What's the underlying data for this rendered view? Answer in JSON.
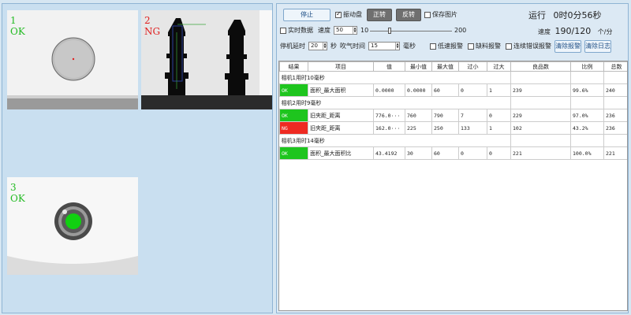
{
  "cameras": [
    {
      "index": "1",
      "result": "OK",
      "color": "#22bb22"
    },
    {
      "index": "2",
      "result": "NG",
      "color": "#e02020"
    },
    {
      "index": "3",
      "result": "OK",
      "color": "#22bb22"
    }
  ],
  "controls": {
    "stop_label": "停止",
    "vibrate_label": "振动盘",
    "forward_label": "正转",
    "reverse_label": "反转",
    "save_image_label": "保存图片",
    "realtime_label": "实时数据",
    "speed_label": "速度",
    "speed_value": "50",
    "slider_min": "10",
    "slider_max": "200",
    "stop_delay_label": "停机延时",
    "stop_delay_value": "20",
    "stop_delay_unit": "秒",
    "blow_time_label": "吹气时间",
    "blow_time_value": "15",
    "blow_time_unit": "毫秒",
    "low_speed_alarm_label": "低速报警",
    "missing_alarm_label": "缺料报警",
    "consecutive_alarm_label": "连续错误报警",
    "clear_alarm_label": "清除报警",
    "clear_log_label": "清除日志"
  },
  "status": {
    "run_label": "运行",
    "run_time": "0时0分56秒",
    "speed_label": "速度",
    "speed_value": "190/120",
    "speed_unit": "个/分"
  },
  "table": {
    "headers": [
      "结果",
      "项目",
      "值",
      "最小值",
      "最大值",
      "过小",
      "过大",
      "良品数",
      "比例",
      "总数"
    ],
    "groups": [
      {
        "title": "相机1用时10毫秒",
        "rows": [
          {
            "result": "OK",
            "item": "面积_最大面积",
            "value": "0.0000",
            "min": "0.0000",
            "max": "60",
            "too_small": "0",
            "too_large": "1",
            "good": "239",
            "ratio": "99.6%",
            "total": "240"
          }
        ]
      },
      {
        "title": "相机2用时9毫秒",
        "rows": [
          {
            "result": "OK",
            "item": "旧夹距_距离",
            "value": "776.0···",
            "min": "760",
            "max": "790",
            "too_small": "7",
            "too_large": "0",
            "good": "229",
            "ratio": "97.0%",
            "total": "236"
          },
          {
            "result": "NG",
            "item": "旧夹距_距离",
            "value": "162.0···",
            "min": "225",
            "max": "250",
            "too_small": "133",
            "too_large": "1",
            "good": "102",
            "ratio": "43.2%",
            "total": "236"
          }
        ]
      },
      {
        "title": "相机3用时14毫秒",
        "rows": [
          {
            "result": "OK",
            "item": "面积_最大面积比",
            "value": "43.4192",
            "min": "30",
            "max": "60",
            "too_small": "0",
            "too_large": "0",
            "good": "221",
            "ratio": "100.0%",
            "total": "221"
          }
        ]
      }
    ]
  }
}
